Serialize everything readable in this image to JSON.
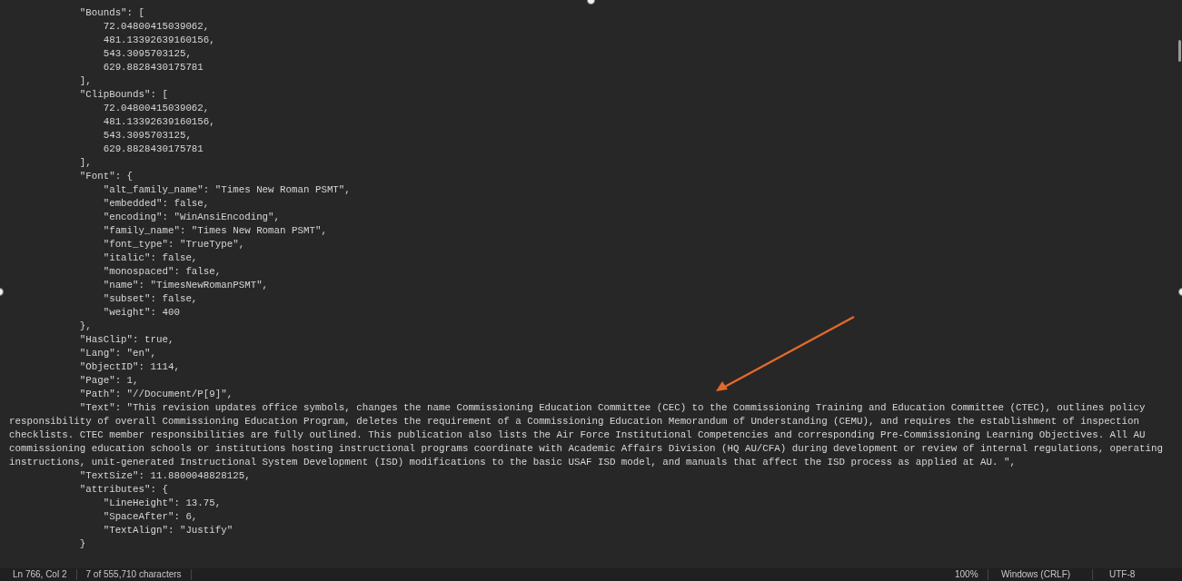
{
  "editor": {
    "lines": [
      "            \"Bounds\": [",
      "                72.04800415039062,",
      "                481.13392639160156,",
      "                543.3095703125,",
      "                629.8828430175781",
      "            ],",
      "            \"ClipBounds\": [",
      "                72.04800415039062,",
      "                481.13392639160156,",
      "                543.3095703125,",
      "                629.8828430175781",
      "            ],",
      "            \"Font\": {",
      "                \"alt_family_name\": \"Times New Roman PSMT\",",
      "                \"embedded\": false,",
      "                \"encoding\": \"WinAnsiEncoding\",",
      "                \"family_name\": \"Times New Roman PSMT\",",
      "                \"font_type\": \"TrueType\",",
      "                \"italic\": false,",
      "                \"monospaced\": false,",
      "                \"name\": \"TimesNewRomanPSMT\",",
      "                \"subset\": false,",
      "                \"weight\": 400",
      "            },",
      "            \"HasClip\": true,",
      "            \"Lang\": \"en\",",
      "            \"ObjectID\": 1114,",
      "            \"Page\": 1,",
      "            \"Path\": \"//Document/P[9]\",",
      "            \"Text\": \"This revision updates office symbols, changes the name Commissioning Education Committee (CEC) to the Commissioning Training and Education Committee (CTEC), outlines policy responsibility of overall Commissioning Education Program, deletes the requirement of a Commissioning Education Memorandum of Understanding (CEMU), and requires the establishment of inspection checklists. CTEC member responsibilities are fully outlined. This publication also lists the Air Force Institutional Competencies and corresponding Pre-Commissioning Learning Objectives. All AU commissioning education schools or institutions hosting instructional programs coordinate with Academic Affairs Division (HQ AU/CFA) during development or review of internal regulations, operating instructions, unit-generated Instructional System Development (ISD) modifications to the basic USAF ISD model, and manuals that affect the ISD process as applied at AU. \",",
      "            \"TextSize\": 11.8800048828125,",
      "            \"attributes\": {",
      "                \"LineHeight\": 13.75,",
      "                \"SpaceAfter\": 6,",
      "                \"TextAlign\": \"Justify\"",
      "            }"
    ]
  },
  "status_bar": {
    "position": "Ln 766, Col 2",
    "characters": "7 of 555,710 characters",
    "zoom": "100%",
    "line_ending": "Windows (CRLF)",
    "encoding": "UTF-8"
  }
}
